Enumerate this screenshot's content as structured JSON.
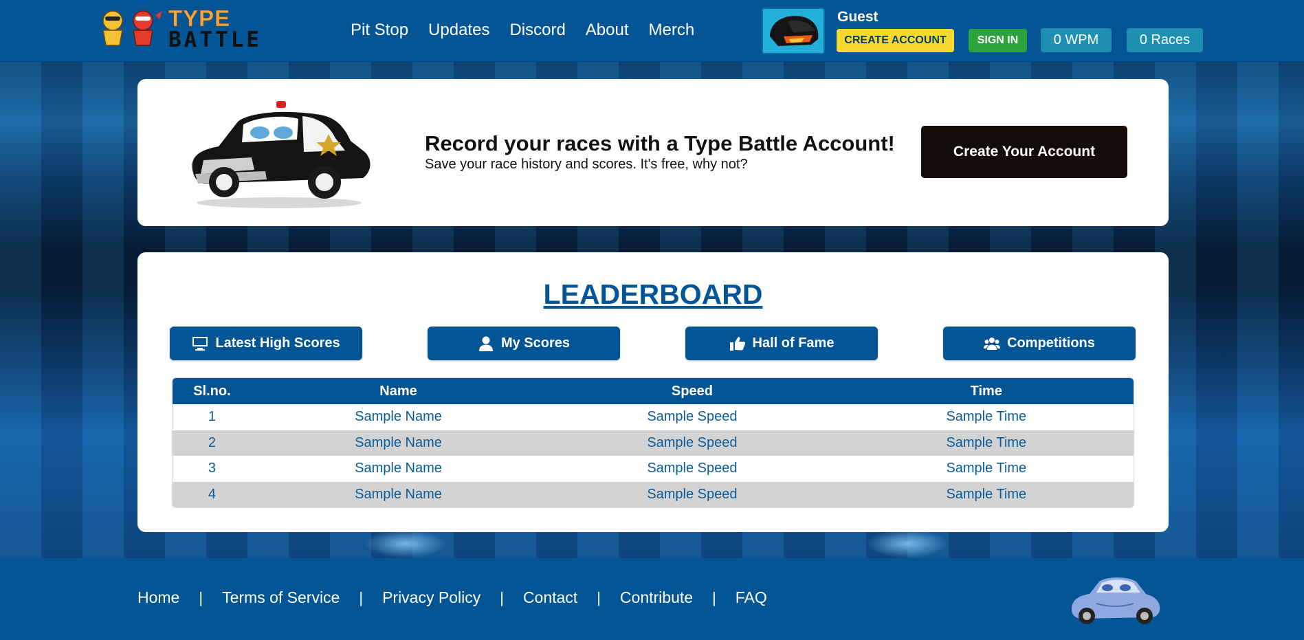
{
  "header": {
    "logo": {
      "line1": "TYPE",
      "line2": "BATTLE"
    },
    "nav": [
      "Pit Stop",
      "Updates",
      "Discord",
      "About",
      "Merch"
    ],
    "user": {
      "name": "Guest",
      "create_account_label": "CREATE ACCOUNT",
      "sign_in_label": "SIGN IN",
      "wpm_label": "0 WPM",
      "races_label": "0 Races"
    }
  },
  "promo": {
    "title": "Record your races with a Type Battle Account!",
    "subtitle": "Save your race history and scores. It's free, why not?",
    "button_label": "Create Your Account"
  },
  "leaderboard": {
    "title": "LEADERBOARD",
    "tabs": [
      {
        "label": "Latest High Scores",
        "icon": "monitor-icon"
      },
      {
        "label": "My Scores",
        "icon": "user-icon"
      },
      {
        "label": "Hall of Fame",
        "icon": "thumbs-up-icon"
      },
      {
        "label": "Competitions",
        "icon": "users-icon"
      }
    ],
    "columns": [
      "Sl.no.",
      "Name",
      "Speed",
      "Time"
    ],
    "rows": [
      {
        "no": "1",
        "name": "Sample Name",
        "speed": "Sample Speed",
        "time": "Sample Time"
      },
      {
        "no": "2",
        "name": "Sample Name",
        "speed": "Sample Speed",
        "time": "Sample Time"
      },
      {
        "no": "3",
        "name": "Sample Name",
        "speed": "Sample Speed",
        "time": "Sample Time"
      },
      {
        "no": "4",
        "name": "Sample Name",
        "speed": "Sample Speed",
        "time": "Sample Time"
      }
    ]
  },
  "footer": {
    "links": [
      "Home",
      "Terms of Service",
      "Privacy Policy",
      "Contact",
      "Contribute",
      "FAQ"
    ],
    "separator": "|"
  },
  "colors": {
    "primary_blue": "#045595",
    "create_yellow": "#f6d92f",
    "signin_green": "#2ca33c",
    "pill_cyan": "#1e8fb0",
    "dark_button": "#140d09"
  }
}
